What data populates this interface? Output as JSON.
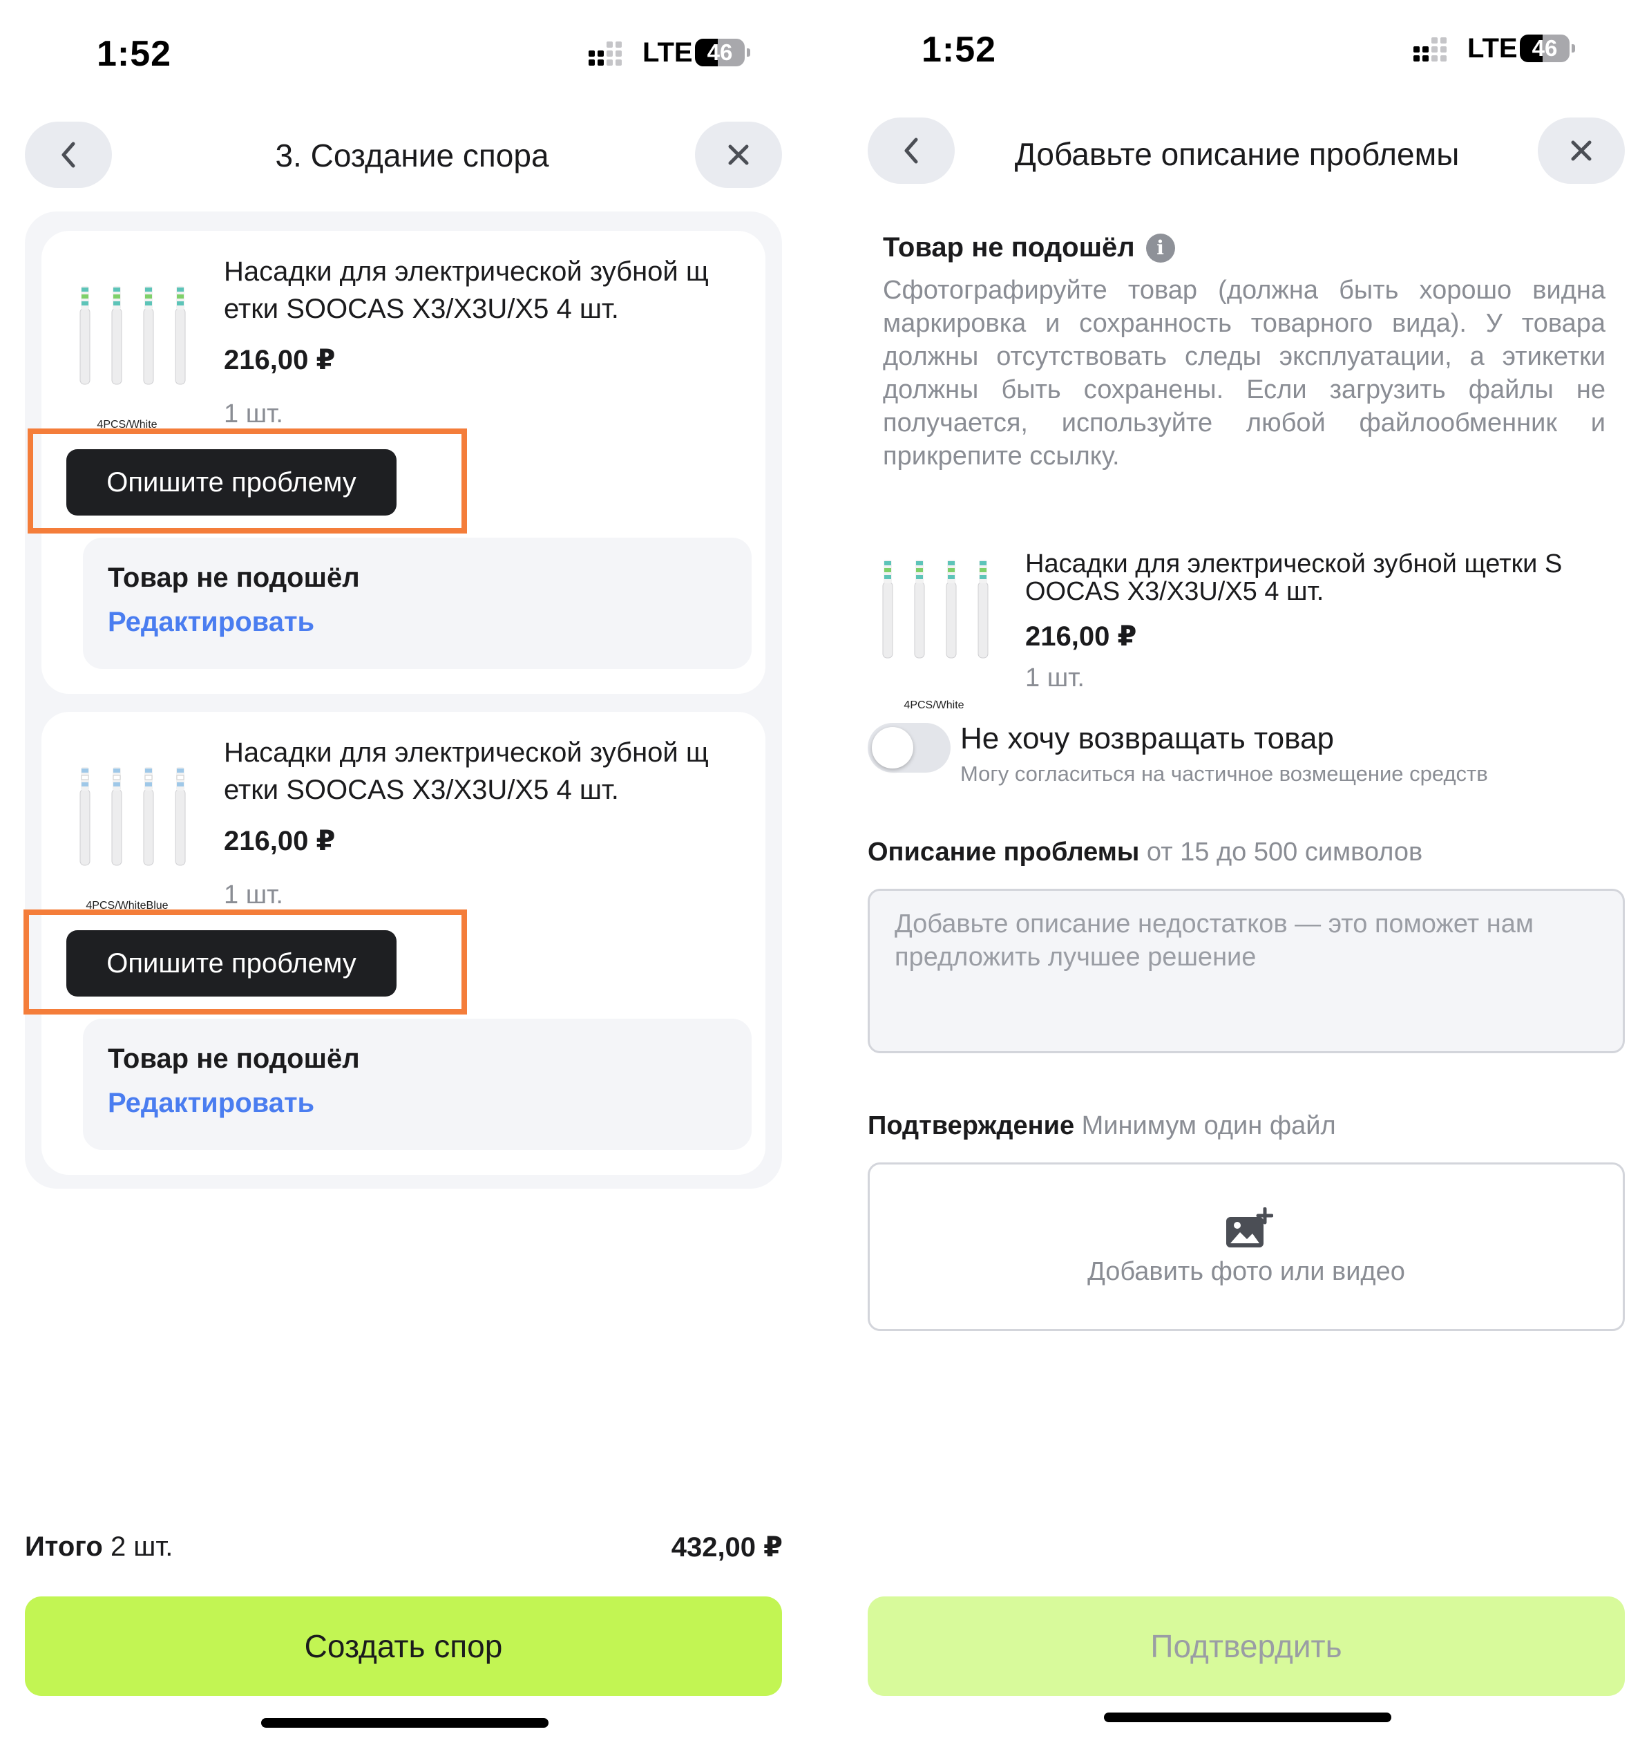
{
  "left": {
    "status": {
      "time": "1:52",
      "network": "LTE",
      "battery": "46"
    },
    "header": {
      "title": "3. Создание спора"
    },
    "items": [
      {
        "thumb_caption": "4PCS/White",
        "name_line1": "Насадки для электрической зубной щ",
        "name_line2": "етки SOOCAS X3/X3U/X5 4 шт.",
        "price": "216,00 ₽",
        "qty": "1 шт.",
        "action_label": "Опишите проблему",
        "reason": "Товар не подошёл",
        "edit_label": "Редактировать"
      },
      {
        "thumb_caption": "4PCS/WhiteBlue",
        "name_line1": "Насадки для электрической зубной щ",
        "name_line2": "етки SOOCAS X3/X3U/X5 4 шт.",
        "price": "216,00 ₽",
        "qty": "1 шт.",
        "action_label": "Опишите проблему",
        "reason": "Товар не подошёл",
        "edit_label": "Редактировать"
      }
    ],
    "total": {
      "label": "Итого",
      "count": "2 шт.",
      "value": "432,00 ₽"
    },
    "submit_label": "Создать спор"
  },
  "right": {
    "status": {
      "time": "1:52",
      "network": "LTE",
      "battery": "46"
    },
    "header": {
      "title": "Добавьте описание проблемы"
    },
    "reason_title": "Товар не подошёл",
    "reason_description": "Сфотографируйте товар (должна быть хорошо видна маркировка и сохранность товарного вида). У товара должны отсутствовать следы эксплуатации, а этикетки должны быть сохранены. Если загрузить файлы не получается, используйте любой файлообменник и прикрепите ссылку.",
    "product": {
      "thumb_caption": "4PCS/White",
      "name_line1": "Насадки для электрической зубной щетки S",
      "name_line2": "OOCAS X3/X3U/X5 4 шт.",
      "price": "216,00 ₽",
      "qty": "1 шт."
    },
    "no_return": {
      "title": "Не хочу возвращать товар",
      "subtitle": "Могу согласиться на частичное возмещение средств",
      "enabled": false
    },
    "description_field": {
      "label": "Описание проблемы",
      "hint": "от 15 до 500 символов",
      "placeholder": "Добавьте описание недостатков — это поможет нам предложить лучшее решение"
    },
    "proof_field": {
      "label": "Подтверждение",
      "hint": "Минимум один файл",
      "upload_label": "Добавить фото или видео"
    },
    "confirm_label": "Подтвердить"
  },
  "colors": {
    "accent_green": "#c2f553",
    "accent_green_disabled": "#d8fa9b",
    "link_blue": "#4a7df0",
    "highlight_orange": "#f47d3a",
    "dark_button": "#1e1f22"
  },
  "icons": {
    "back": "chevron-left-icon",
    "close": "close-icon",
    "info": "info-icon",
    "upload": "add-photo-icon"
  }
}
